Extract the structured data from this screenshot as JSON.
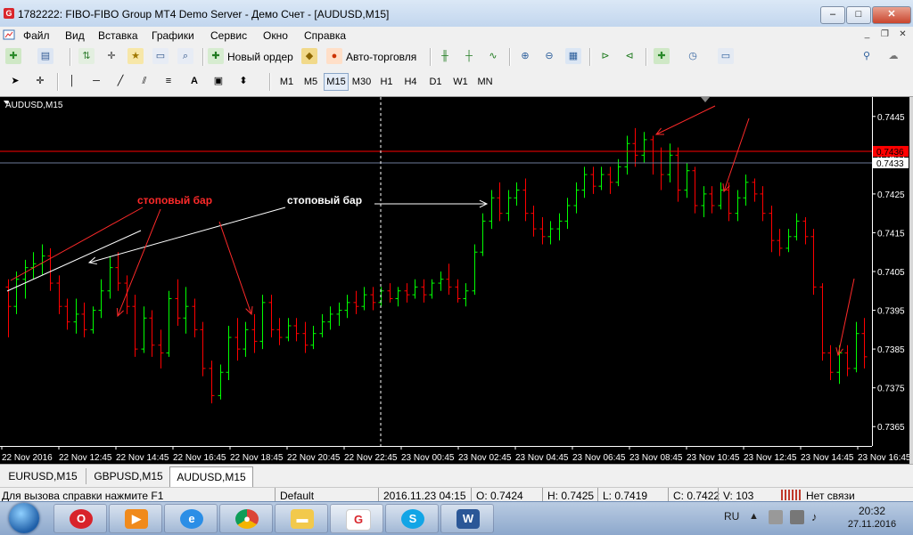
{
  "window": {
    "title": "1782222: FIBO-FIBO Group MT4 Demo Server - Демо Счет - [AUDUSD,M15]",
    "app_icon": "G",
    "minimize": "–",
    "maximize": "□",
    "close": "✕",
    "mdi_min": "_",
    "mdi_restore": "❐",
    "mdi_close": "✕"
  },
  "menu": [
    "Файл",
    "Вид",
    "Вставка",
    "Графики",
    "Сервис",
    "Окно",
    "Справка"
  ],
  "toolbar1": {
    "new_order": "Новый ордер",
    "autotrading": "Авто-торговля"
  },
  "toolbar2": {
    "timeframes": [
      "M1",
      "M5",
      "M15",
      "M30",
      "H1",
      "H4",
      "D1",
      "W1",
      "MN"
    ],
    "active_timeframe": "M15",
    "text_tool": "A"
  },
  "chart_data": {
    "type": "bar",
    "symbol_label": "AUDUSD,M15",
    "y_ticks": [
      "0.7445",
      "0.7435",
      "0.7425",
      "0.7415",
      "0.7405",
      "0.7395",
      "0.7385",
      "0.7375",
      "0.7365"
    ],
    "ylim": [
      0.736,
      0.745
    ],
    "x_ticks": [
      "22 Nov 2016",
      "22 Nov 12:45",
      "22 Nov 14:45",
      "22 Nov 16:45",
      "22 Nov 18:45",
      "22 Nov 20:45",
      "22 Nov 22:45",
      "23 Nov 00:45",
      "23 Nov 02:45",
      "23 Nov 04:45",
      "23 Nov 06:45",
      "23 Nov 08:45",
      "23 Nov 10:45",
      "23 Nov 12:45",
      "23 Nov 14:45",
      "23 Nov 16:45"
    ],
    "ask_line": {
      "label": "0.7436",
      "value": 0.7436,
      "color": "#ff0000"
    },
    "bid_line": {
      "label": "0.7433",
      "value": 0.7433,
      "color": "#6b7a99"
    },
    "up_color": "#00ff00",
    "down_color": "#ff0000",
    "background": "#000000",
    "annotations": [
      {
        "text": "стоповый бар",
        "color": "#ff2a2a"
      },
      {
        "text": "стоповый бар",
        "color": "#ffffff"
      }
    ],
    "bars": [
      {
        "o": 0.7401,
        "h": 0.7403,
        "l": 0.7388,
        "c": 0.7396
      },
      {
        "o": 0.7396,
        "h": 0.7405,
        "l": 0.7394,
        "c": 0.7403
      },
      {
        "o": 0.7403,
        "h": 0.7408,
        "l": 0.7398,
        "c": 0.7406
      },
      {
        "o": 0.7406,
        "h": 0.741,
        "l": 0.7403,
        "c": 0.7407
      },
      {
        "o": 0.7407,
        "h": 0.7412,
        "l": 0.7404,
        "c": 0.7409
      },
      {
        "o": 0.7409,
        "h": 0.7411,
        "l": 0.74,
        "c": 0.7402
      },
      {
        "o": 0.7402,
        "h": 0.7404,
        "l": 0.7394,
        "c": 0.7396
      },
      {
        "o": 0.7396,
        "h": 0.7398,
        "l": 0.739,
        "c": 0.7392
      },
      {
        "o": 0.7392,
        "h": 0.7398,
        "l": 0.7389,
        "c": 0.7394
      },
      {
        "o": 0.7394,
        "h": 0.7397,
        "l": 0.7388,
        "c": 0.739
      },
      {
        "o": 0.739,
        "h": 0.7396,
        "l": 0.7389,
        "c": 0.7395
      },
      {
        "o": 0.7395,
        "h": 0.7403,
        "l": 0.7393,
        "c": 0.74
      },
      {
        "o": 0.74,
        "h": 0.7409,
        "l": 0.7398,
        "c": 0.7406
      },
      {
        "o": 0.7406,
        "h": 0.741,
        "l": 0.74,
        "c": 0.7402
      },
      {
        "o": 0.7402,
        "h": 0.7404,
        "l": 0.7394,
        "c": 0.7396
      },
      {
        "o": 0.7396,
        "h": 0.7399,
        "l": 0.7383,
        "c": 0.7385
      },
      {
        "o": 0.7385,
        "h": 0.7396,
        "l": 0.7384,
        "c": 0.7393
      },
      {
        "o": 0.7393,
        "h": 0.7395,
        "l": 0.7383,
        "c": 0.7386
      },
      {
        "o": 0.7386,
        "h": 0.739,
        "l": 0.738,
        "c": 0.7384
      },
      {
        "o": 0.7384,
        "h": 0.74,
        "l": 0.7383,
        "c": 0.7398
      },
      {
        "o": 0.7398,
        "h": 0.7403,
        "l": 0.7391,
        "c": 0.7393
      },
      {
        "o": 0.7393,
        "h": 0.7401,
        "l": 0.7389,
        "c": 0.7396
      },
      {
        "o": 0.7396,
        "h": 0.7398,
        "l": 0.7388,
        "c": 0.739
      },
      {
        "o": 0.739,
        "h": 0.7392,
        "l": 0.7378,
        "c": 0.738
      },
      {
        "o": 0.738,
        "h": 0.7382,
        "l": 0.7371,
        "c": 0.7373
      },
      {
        "o": 0.7373,
        "h": 0.7381,
        "l": 0.7372,
        "c": 0.7379
      },
      {
        "o": 0.7379,
        "h": 0.7391,
        "l": 0.7377,
        "c": 0.7388
      },
      {
        "o": 0.7388,
        "h": 0.7393,
        "l": 0.7382,
        "c": 0.7385
      },
      {
        "o": 0.7385,
        "h": 0.7392,
        "l": 0.7383,
        "c": 0.739
      },
      {
        "o": 0.739,
        "h": 0.7394,
        "l": 0.7384,
        "c": 0.7387
      },
      {
        "o": 0.7387,
        "h": 0.7399,
        "l": 0.7385,
        "c": 0.7397
      },
      {
        "o": 0.7397,
        "h": 0.7399,
        "l": 0.7388,
        "c": 0.739
      },
      {
        "o": 0.739,
        "h": 0.7393,
        "l": 0.7386,
        "c": 0.7388
      },
      {
        "o": 0.7388,
        "h": 0.7393,
        "l": 0.7387,
        "c": 0.7391
      },
      {
        "o": 0.7391,
        "h": 0.7393,
        "l": 0.7387,
        "c": 0.7389
      },
      {
        "o": 0.7389,
        "h": 0.7392,
        "l": 0.7384,
        "c": 0.7386
      },
      {
        "o": 0.7386,
        "h": 0.7391,
        "l": 0.7385,
        "c": 0.7389
      },
      {
        "o": 0.7389,
        "h": 0.7394,
        "l": 0.7388,
        "c": 0.7392
      },
      {
        "o": 0.7392,
        "h": 0.7396,
        "l": 0.739,
        "c": 0.7394
      },
      {
        "o": 0.7394,
        "h": 0.7397,
        "l": 0.7391,
        "c": 0.7395
      },
      {
        "o": 0.7395,
        "h": 0.7399,
        "l": 0.7393,
        "c": 0.7397
      },
      {
        "o": 0.7397,
        "h": 0.74,
        "l": 0.7394,
        "c": 0.7396
      },
      {
        "o": 0.7396,
        "h": 0.7401,
        "l": 0.7395,
        "c": 0.7399
      },
      {
        "o": 0.7399,
        "h": 0.7401,
        "l": 0.7395,
        "c": 0.7397
      },
      {
        "o": 0.7397,
        "h": 0.7401,
        "l": 0.7396,
        "c": 0.74
      },
      {
        "o": 0.74,
        "h": 0.7402,
        "l": 0.7397,
        "c": 0.7398
      },
      {
        "o": 0.7398,
        "h": 0.7401,
        "l": 0.7396,
        "c": 0.74
      },
      {
        "o": 0.74,
        "h": 0.7402,
        "l": 0.7397,
        "c": 0.7399
      },
      {
        "o": 0.7399,
        "h": 0.7403,
        "l": 0.7398,
        "c": 0.7401
      },
      {
        "o": 0.7401,
        "h": 0.7403,
        "l": 0.7397,
        "c": 0.7399
      },
      {
        "o": 0.7399,
        "h": 0.7403,
        "l": 0.7398,
        "c": 0.7402
      },
      {
        "o": 0.7402,
        "h": 0.7405,
        "l": 0.74,
        "c": 0.7403
      },
      {
        "o": 0.7403,
        "h": 0.7407,
        "l": 0.7399,
        "c": 0.7401
      },
      {
        "o": 0.7401,
        "h": 0.7403,
        "l": 0.7397,
        "c": 0.7398
      },
      {
        "o": 0.7398,
        "h": 0.7402,
        "l": 0.7396,
        "c": 0.74
      },
      {
        "o": 0.74,
        "h": 0.7412,
        "l": 0.7399,
        "c": 0.741
      },
      {
        "o": 0.741,
        "h": 0.742,
        "l": 0.7409,
        "c": 0.7418
      },
      {
        "o": 0.7418,
        "h": 0.7426,
        "l": 0.7416,
        "c": 0.7424
      },
      {
        "o": 0.7424,
        "h": 0.7428,
        "l": 0.7418,
        "c": 0.742
      },
      {
        "o": 0.742,
        "h": 0.7426,
        "l": 0.7418,
        "c": 0.7424
      },
      {
        "o": 0.7424,
        "h": 0.7428,
        "l": 0.7422,
        "c": 0.7426
      },
      {
        "o": 0.7426,
        "h": 0.7429,
        "l": 0.7418,
        "c": 0.742
      },
      {
        "o": 0.742,
        "h": 0.7422,
        "l": 0.7414,
        "c": 0.7416
      },
      {
        "o": 0.7416,
        "h": 0.7419,
        "l": 0.7412,
        "c": 0.7414
      },
      {
        "o": 0.7414,
        "h": 0.7418,
        "l": 0.7412,
        "c": 0.7416
      },
      {
        "o": 0.7416,
        "h": 0.742,
        "l": 0.7413,
        "c": 0.7418
      },
      {
        "o": 0.7418,
        "h": 0.7424,
        "l": 0.7416,
        "c": 0.7422
      },
      {
        "o": 0.7422,
        "h": 0.7428,
        "l": 0.742,
        "c": 0.7426
      },
      {
        "o": 0.7426,
        "h": 0.7432,
        "l": 0.7424,
        "c": 0.743
      },
      {
        "o": 0.743,
        "h": 0.7432,
        "l": 0.7425,
        "c": 0.7427
      },
      {
        "o": 0.7427,
        "h": 0.7432,
        "l": 0.7426,
        "c": 0.743
      },
      {
        "o": 0.743,
        "h": 0.7432,
        "l": 0.7425,
        "c": 0.7428
      },
      {
        "o": 0.7428,
        "h": 0.7434,
        "l": 0.7427,
        "c": 0.7432
      },
      {
        "o": 0.7432,
        "h": 0.744,
        "l": 0.743,
        "c": 0.7438
      },
      {
        "o": 0.7438,
        "h": 0.7442,
        "l": 0.7432,
        "c": 0.7435
      },
      {
        "o": 0.7435,
        "h": 0.7441,
        "l": 0.7433,
        "c": 0.7439
      },
      {
        "o": 0.7439,
        "h": 0.744,
        "l": 0.743,
        "c": 0.7433
      },
      {
        "o": 0.7433,
        "h": 0.7437,
        "l": 0.7426,
        "c": 0.743
      },
      {
        "o": 0.743,
        "h": 0.7438,
        "l": 0.7428,
        "c": 0.7435
      },
      {
        "o": 0.7435,
        "h": 0.7437,
        "l": 0.7423,
        "c": 0.7426
      },
      {
        "o": 0.7426,
        "h": 0.7433,
        "l": 0.7424,
        "c": 0.7431
      },
      {
        "o": 0.7431,
        "h": 0.7432,
        "l": 0.742,
        "c": 0.7422
      },
      {
        "o": 0.7422,
        "h": 0.7427,
        "l": 0.7419,
        "c": 0.7425
      },
      {
        "o": 0.7425,
        "h": 0.7427,
        "l": 0.742,
        "c": 0.7422
      },
      {
        "o": 0.7422,
        "h": 0.7428,
        "l": 0.7421,
        "c": 0.7426
      },
      {
        "o": 0.7426,
        "h": 0.7428,
        "l": 0.7418,
        "c": 0.742
      },
      {
        "o": 0.742,
        "h": 0.7426,
        "l": 0.7418,
        "c": 0.7424
      },
      {
        "o": 0.7424,
        "h": 0.743,
        "l": 0.7422,
        "c": 0.7428
      },
      {
        "o": 0.7428,
        "h": 0.7429,
        "l": 0.7423,
        "c": 0.7425
      },
      {
        "o": 0.7425,
        "h": 0.7427,
        "l": 0.7418,
        "c": 0.742
      },
      {
        "o": 0.742,
        "h": 0.7422,
        "l": 0.741,
        "c": 0.7413
      },
      {
        "o": 0.7413,
        "h": 0.7416,
        "l": 0.7409,
        "c": 0.7411
      },
      {
        "o": 0.7411,
        "h": 0.7416,
        "l": 0.741,
        "c": 0.7414
      },
      {
        "o": 0.7414,
        "h": 0.742,
        "l": 0.7413,
        "c": 0.7418
      },
      {
        "o": 0.7418,
        "h": 0.7419,
        "l": 0.7412,
        "c": 0.7414
      },
      {
        "o": 0.7414,
        "h": 0.7416,
        "l": 0.7399,
        "c": 0.7401
      },
      {
        "o": 0.7401,
        "h": 0.7402,
        "l": 0.7382,
        "c": 0.7384
      },
      {
        "o": 0.7384,
        "h": 0.7386,
        "l": 0.7377,
        "c": 0.7379
      },
      {
        "o": 0.7379,
        "h": 0.7386,
        "l": 0.7376,
        "c": 0.7384
      },
      {
        "o": 0.7384,
        "h": 0.7386,
        "l": 0.7378,
        "c": 0.738
      },
      {
        "o": 0.738,
        "h": 0.7392,
        "l": 0.7379,
        "c": 0.7389
      },
      {
        "o": 0.7389,
        "h": 0.7393,
        "l": 0.738,
        "c": 0.7383
      }
    ]
  },
  "tabs": [
    "EURUSD,M15",
    "GBPUSD,M15",
    "AUDUSD,M15"
  ],
  "active_tab": "AUDUSD,M15",
  "status": {
    "help": "Для вызова справки нажмите F1",
    "profile": "Default",
    "datetime": "2016.11.23 04:15",
    "open": "O: 0.7424",
    "high": "H: 0.7425",
    "low": "L: 0.7419",
    "close": "C: 0.7422",
    "volume": "V: 103",
    "connection": "Нет связи"
  },
  "taskbar": {
    "lang": "RU",
    "time": "20:32",
    "date": "27.11.2016",
    "apps": [
      "start-button",
      "opera",
      "media-player",
      "internet-explorer",
      "chrome",
      "file-explorer",
      "fibo-group",
      "skype",
      "word"
    ]
  }
}
